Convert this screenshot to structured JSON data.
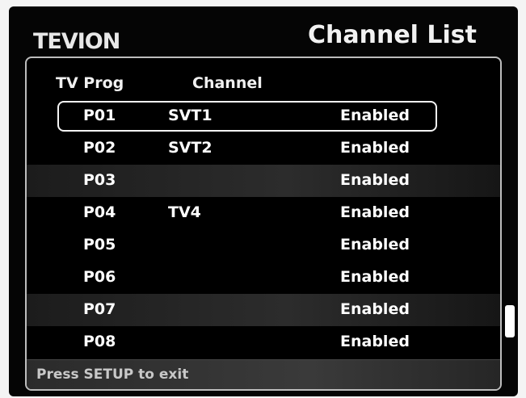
{
  "brand": "TEVION",
  "title": "Channel List",
  "columns": {
    "prog": "TV Prog",
    "channel": "Channel"
  },
  "rows": [
    {
      "prog": "P01",
      "channel": "SVT1",
      "status": "Enabled"
    },
    {
      "prog": "P02",
      "channel": "SVT2",
      "status": "Enabled"
    },
    {
      "prog": "P03",
      "channel": "",
      "status": "Enabled"
    },
    {
      "prog": "P04",
      "channel": "TV4",
      "status": "Enabled"
    },
    {
      "prog": "P05",
      "channel": "",
      "status": "Enabled"
    },
    {
      "prog": "P06",
      "channel": "",
      "status": "Enabled"
    },
    {
      "prog": "P07",
      "channel": "",
      "status": "Enabled"
    },
    {
      "prog": "P08",
      "channel": "",
      "status": "Enabled"
    }
  ],
  "footer": "Press SETUP to exit"
}
